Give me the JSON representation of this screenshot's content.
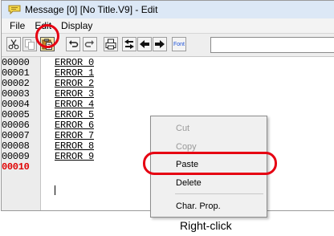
{
  "window": {
    "title": "Message [0] [No Title.V9] - Edit"
  },
  "menu": [
    "File",
    "Edit",
    "Display"
  ],
  "toolbar": {
    "buttons": [
      {
        "name": "cut-icon"
      },
      {
        "name": "copy-icon"
      },
      {
        "name": "paste-icon"
      },
      {
        "name": "undo-icon"
      },
      {
        "name": "redo-icon"
      },
      {
        "name": "print-icon"
      },
      {
        "name": "switch-icon"
      },
      {
        "name": "previous-icon"
      },
      {
        "name": "next-icon"
      }
    ],
    "font_label": "Font"
  },
  "lines": [
    {
      "num": "00000",
      "text": "ERROR 0"
    },
    {
      "num": "00001",
      "text": "ERROR 1"
    },
    {
      "num": "00002",
      "text": "ERROR 2"
    },
    {
      "num": "00003",
      "text": "ERROR 3"
    },
    {
      "num": "00004",
      "text": "ERROR 4"
    },
    {
      "num": "00005",
      "text": "ERROR 5"
    },
    {
      "num": "00006",
      "text": "ERROR 6"
    },
    {
      "num": "00007",
      "text": "ERROR 7"
    },
    {
      "num": "00008",
      "text": "ERROR 8"
    },
    {
      "num": "00009",
      "text": "ERROR 9"
    },
    {
      "num": "00010",
      "text": ""
    }
  ],
  "context_menu": {
    "cut": "Cut",
    "copy": "Copy",
    "paste": "Paste",
    "delete": "Delete",
    "char_prop": "Char. Prop."
  },
  "caption": "Right-click",
  "colors": {
    "highlight": "#e60012",
    "current_line": "#e00000"
  }
}
